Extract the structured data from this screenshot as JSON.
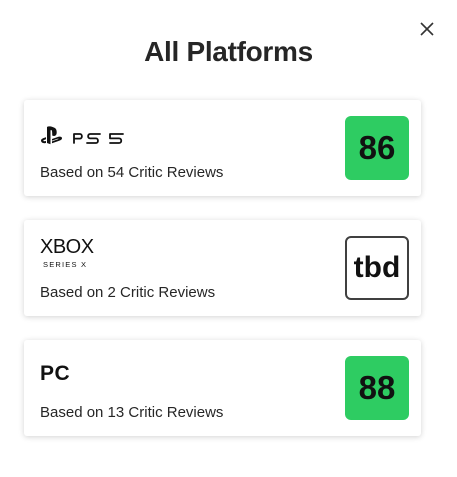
{
  "dialog": {
    "title": "All Platforms",
    "close_icon": "close-icon"
  },
  "platforms": [
    {
      "name": "PS5",
      "logo_icon": "ps5-logo-icon",
      "reviews": "Based on 54 Critic Reviews",
      "score": "86",
      "score_color": "#2ecc62"
    },
    {
      "name": "XBOX",
      "subtitle": "SERIES X",
      "logo_icon": "xbox-series-x-logo-icon",
      "reviews": "Based on 2 Critic Reviews",
      "score": "tbd",
      "score_color": "#ffffff"
    },
    {
      "name": "PC",
      "logo_icon": "pc-label",
      "reviews": "Based on 13 Critic Reviews",
      "score": "88",
      "score_color": "#2ecc62"
    }
  ]
}
